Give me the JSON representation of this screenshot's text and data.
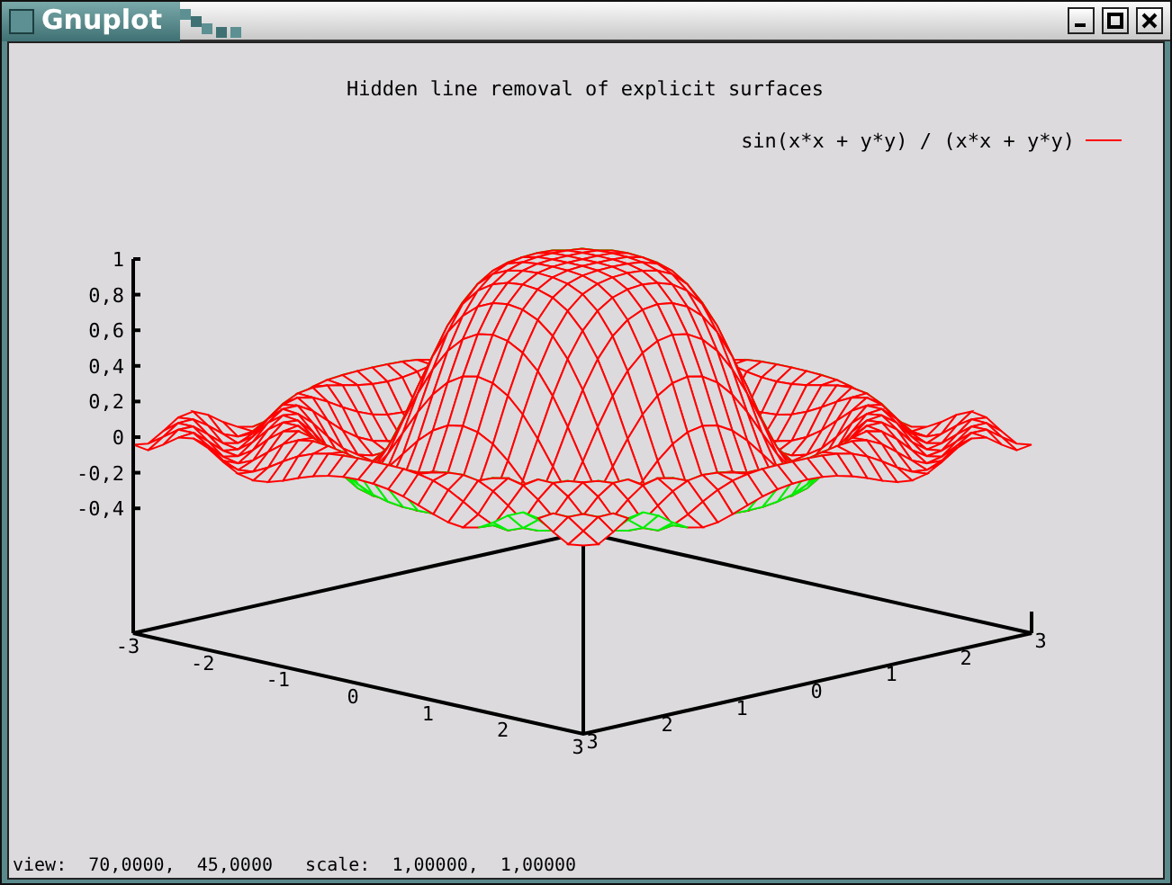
{
  "window": {
    "title": "Gnuplot"
  },
  "plot": {
    "title": "Hidden line removal of explicit surfaces",
    "legend": {
      "label": "sin(x*x + y*y) / (x*x + y*y)"
    },
    "z_ticks": [
      "1",
      "0,8",
      "0,6",
      "0,4",
      "0,2",
      "0",
      "-0,2",
      "-0,4"
    ],
    "x_ticks": [
      "-3",
      "-2",
      "-1",
      "0",
      "1",
      "2",
      "3"
    ],
    "y_ticks": [
      "3",
      "2",
      "1",
      "0",
      "1",
      "2",
      "3"
    ]
  },
  "status_bar": {
    "text": "view:  70,0000,  45,0000   scale:  1,00000,  1,00000"
  }
}
